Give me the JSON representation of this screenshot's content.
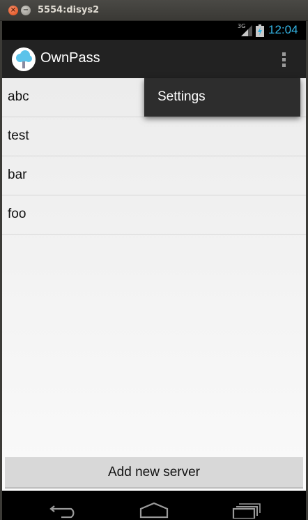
{
  "window": {
    "title": "5554:disys2",
    "close_glyph": "×",
    "minimize_glyph": "−"
  },
  "status_bar": {
    "network_type": "3G",
    "time": "12:04",
    "clock_color": "#33b5e5",
    "icons": [
      "signal-icon",
      "battery-charging-icon"
    ]
  },
  "action_bar": {
    "app_title": "OwnPass",
    "app_icon": "cloud-tree-icon",
    "overflow_icon": "overflow-menu-icon"
  },
  "server_list": {
    "items": [
      {
        "label": "abc"
      },
      {
        "label": "test"
      },
      {
        "label": "bar"
      },
      {
        "label": "foo"
      }
    ]
  },
  "add_server_button": {
    "label": "Add new server"
  },
  "overflow_menu": {
    "items": [
      {
        "label": "Settings"
      }
    ]
  },
  "nav_bar": {
    "icons": [
      "back-icon",
      "home-icon",
      "recent-apps-icon"
    ]
  }
}
